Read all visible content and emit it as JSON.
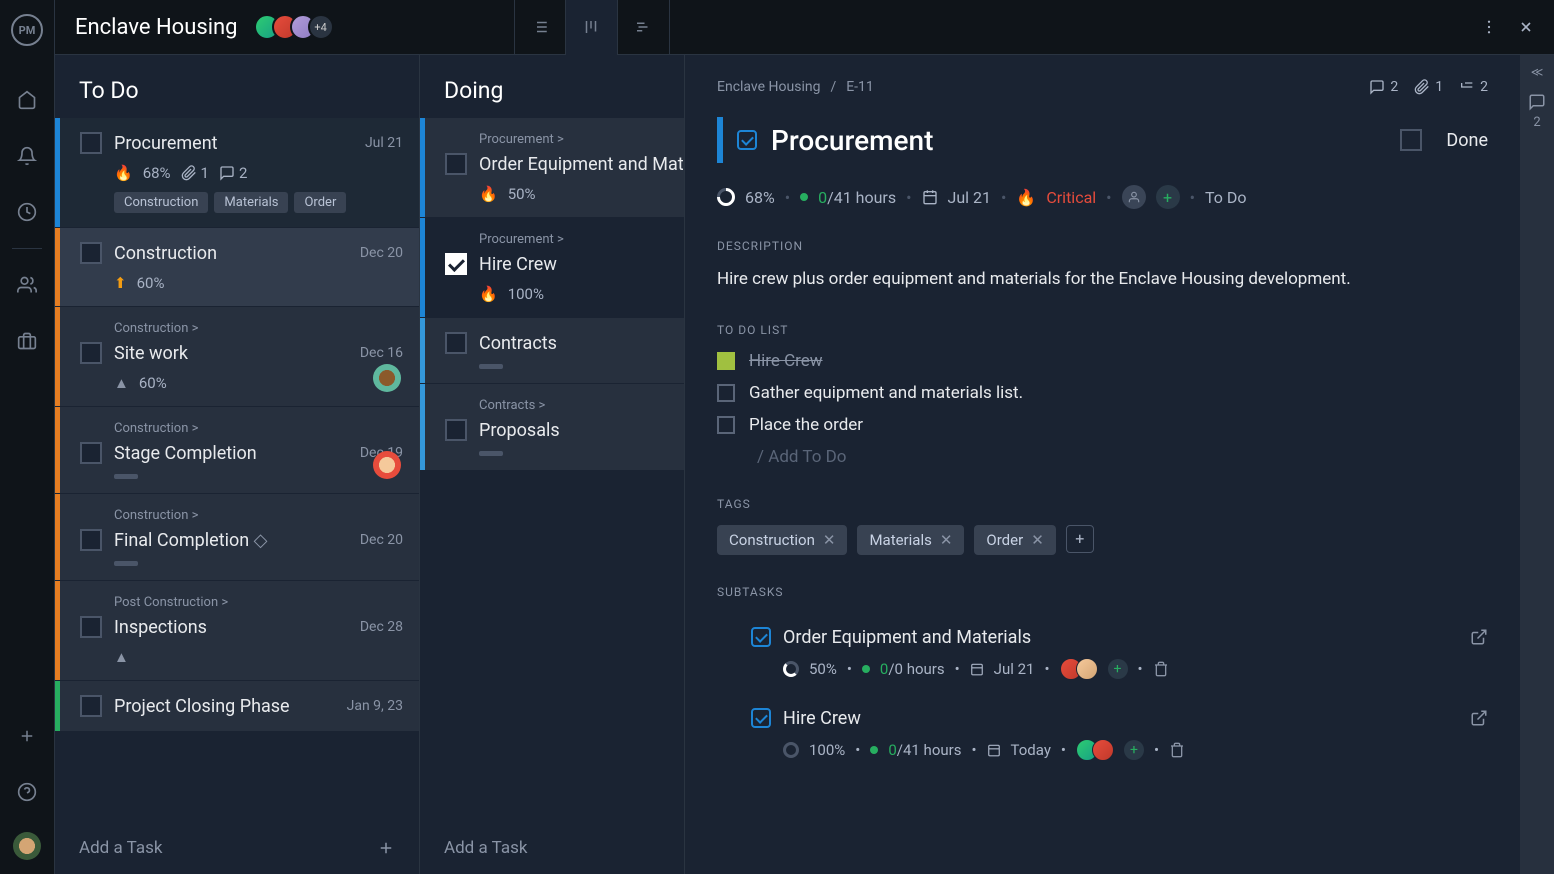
{
  "app": {
    "logo": "PM"
  },
  "topbar": {
    "title": "Enclave Housing",
    "avatars_more": "+4"
  },
  "columns": {
    "todo": {
      "title": "To Do",
      "add": "Add a Task"
    },
    "doing": {
      "title": "Doing",
      "add": "Add a Task"
    }
  },
  "todo_cards": [
    {
      "title": "Procurement",
      "date": "Jul 21",
      "pct": "68%",
      "attach": "1",
      "comments": "2",
      "tags": [
        "Construction",
        "Materials",
        "Order"
      ]
    },
    {
      "title": "Construction",
      "date": "Dec 20",
      "pct": "60%"
    },
    {
      "parent": "Construction >",
      "title": "Site work",
      "date": "Dec 16",
      "pct": "60%"
    },
    {
      "parent": "Construction >",
      "title": "Stage Completion",
      "date": "Dec 19"
    },
    {
      "parent": "Construction >",
      "title": "Final Completion",
      "date": "Dec 20"
    },
    {
      "parent": "Post Construction >",
      "title": "Inspections",
      "date": "Dec 28"
    },
    {
      "title": "Project Closing Phase",
      "date": "Jan 9, 23"
    }
  ],
  "doing_cards": [
    {
      "parent": "Procurement >",
      "title": "Order Equipment and Materials",
      "pct": "50%"
    },
    {
      "parent": "Procurement >",
      "title": "Hire Crew",
      "pct": "100%",
      "done": true
    },
    {
      "title": "Contracts"
    },
    {
      "parent": "Contracts >",
      "title": "Proposals"
    }
  ],
  "detail": {
    "breadcrumb_project": "Enclave Housing",
    "breadcrumb_id": "E-11",
    "stats": {
      "comments": "2",
      "attachments": "1",
      "subtasks": "2"
    },
    "title": "Procurement",
    "done_label": "Done",
    "meta": {
      "progress": "68%",
      "hours_done": "0",
      "hours_total": "/41 hours",
      "date": "Jul 21",
      "priority": "Critical",
      "status": "To Do"
    },
    "description_label": "DESCRIPTION",
    "description": "Hire crew plus order equipment and materials for the Enclave Housing development.",
    "todo_label": "TO DO LIST",
    "todos": [
      {
        "text": "Hire Crew",
        "done": true
      },
      {
        "text": "Gather equipment and materials list.",
        "done": false
      },
      {
        "text": "Place the order",
        "done": false
      }
    ],
    "add_todo": "/ Add To Do",
    "tags_label": "TAGS",
    "tags": [
      "Construction",
      "Materials",
      "Order"
    ],
    "subtasks_label": "SUBTASKS",
    "subtasks": [
      {
        "title": "Order Equipment and Materials",
        "pct": "50%",
        "hours_done": "0",
        "hours_total": "/0 hours",
        "date": "Jul 21"
      },
      {
        "title": "Hire Crew",
        "pct": "100%",
        "hours_done": "0",
        "hours_total": "/41 hours",
        "date": "Today"
      }
    ]
  },
  "right_rail": {
    "count": "2"
  }
}
